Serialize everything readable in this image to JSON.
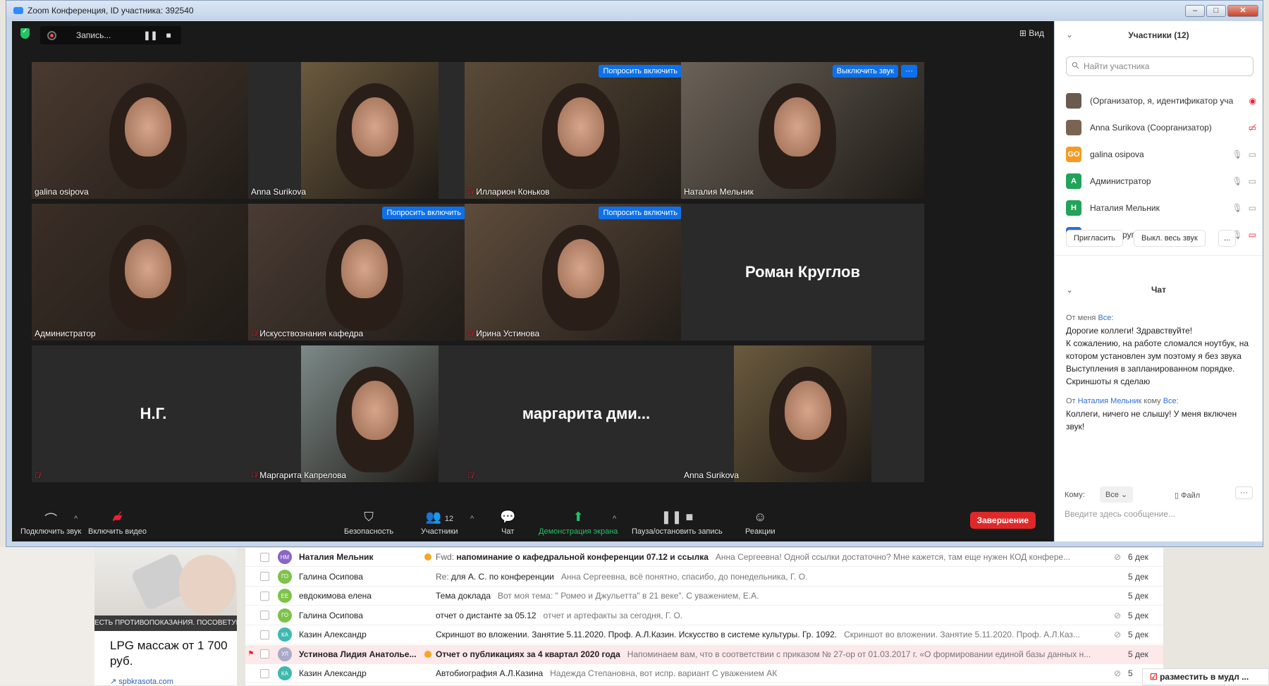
{
  "window": {
    "title": "Zoom Конференция, ID участника: 392540"
  },
  "recording": {
    "label": "Запись..."
  },
  "view_label": "Вид",
  "tiles": [
    {
      "name": "galina osipova",
      "button": "",
      "muted": false,
      "big": ""
    },
    {
      "name": "Anna Surikova",
      "button": "",
      "muted": false,
      "big": ""
    },
    {
      "name": "Илларион Коньков",
      "button": "Попросить включить",
      "muted": true,
      "big": ""
    },
    {
      "name": "Наталия Мельник",
      "button": "Выключить звук",
      "muted": false,
      "big": ""
    },
    {
      "name": "Администратор",
      "button": "",
      "muted": false,
      "big": ""
    },
    {
      "name": "Искусствознания кафедра",
      "button": "Попросить включить",
      "muted": true,
      "big": ""
    },
    {
      "name": "Ирина Устинова",
      "button": "Попросить включить",
      "muted": true,
      "big": ""
    },
    {
      "name": "",
      "button": "",
      "muted": false,
      "big": "Роман Круглов"
    },
    {
      "name": "",
      "button": "",
      "muted": true,
      "big": "Н.Г."
    },
    {
      "name": "Маргарита Капрелова",
      "button": "",
      "muted": true,
      "big": ""
    },
    {
      "name": "",
      "button": "",
      "muted": true,
      "big": "маргарита дми..."
    },
    {
      "name": "Anna Surikova",
      "button": "",
      "muted": false,
      "big": ""
    }
  ],
  "more_label": "···",
  "toolbar": {
    "audio": "Подключить звук",
    "video": "Включить видео",
    "security": "Безопасность",
    "participants": "Участники",
    "participants_count": "12",
    "chat": "Чат",
    "share": "Демонстрация экрана",
    "record": "Пауза/остановить запись",
    "reactions": "Реакции",
    "end": "Завершение"
  },
  "panel": {
    "title": "Участники (12)",
    "search_placeholder": "Найти участника",
    "participants": [
      {
        "initials": "",
        "color": "#6b5a4e",
        "name": "(Организатор, я, идентификатор уча"
      },
      {
        "initials": "",
        "color": "#7a6352",
        "name": "Anna Surikova (Соорганизатор)"
      },
      {
        "initials": "GO",
        "color": "#f59b23",
        "name": "galina osipova"
      },
      {
        "initials": "A",
        "color": "#23a35a",
        "name": "Администратор"
      },
      {
        "initials": "Н",
        "color": "#23a35a",
        "name": "Наталия Мельник"
      },
      {
        "initials": "Р",
        "color": "#2d6fd6",
        "name": "Роман Круглов"
      }
    ],
    "invite": "Пригласить",
    "mute_all": "Выкл. весь звук",
    "more": "...",
    "chat_title": "Чат",
    "messages": [
      {
        "from_prefix": "От меня",
        "to": "Все:",
        "text": "Дорогие коллеги! Здравствуйте!\nК сожалению, на работе сломался ноутбук, на котором установлен зум поэтому я без звука\nВыступления в запланированном порядке.\nСкриншоты я сделаю"
      },
      {
        "from_prefix": "От",
        "sender": "Наталия Мельник",
        "mid": "кому",
        "to": "Все:",
        "text": "Коллеги, ничего не слышу! У меня включен звук!"
      }
    ],
    "to_label": "Кому:",
    "to_value": "Все",
    "file_label": "Файл",
    "input_placeholder": "Введите здесь сообщение..."
  },
  "mail": [
    {
      "avatar": "НМ",
      "color": "#8a64c8",
      "sender": "Наталия Мельник",
      "bold": true,
      "dot": true,
      "prefix": "Fwd:",
      "subject": "напоминание о кафедральной конференции 07.12 и ссылка",
      "snippet": "Анна Сергеевна! Одной ссылки достаточно? Мне кажется, там еще нужен КОД конфере...",
      "clip": true,
      "date": "6 дек",
      "flag": false,
      "hl": false
    },
    {
      "avatar": "ГО",
      "color": "#7ec24a",
      "sender": "Галина Осипова",
      "bold": false,
      "dot": false,
      "prefix": "Re:",
      "subject": "для А. С. по конференции",
      "snippet": "Анна Сергеевна, всё понятно, спасибо, до понедельника, Г. О.",
      "clip": false,
      "date": "5 дек",
      "flag": false,
      "hl": false
    },
    {
      "avatar": "ЕЕ",
      "color": "#7ec24a",
      "sender": "евдокимова елена",
      "bold": false,
      "dot": false,
      "prefix": "",
      "subject": "Тема доклада",
      "snippet": "Вот моя тема: \" Ромео и Джульетта\" в 21 веке\". С уважением, Е.А.",
      "clip": false,
      "date": "5 дек",
      "flag": false,
      "hl": false
    },
    {
      "avatar": "ГО",
      "color": "#7ec24a",
      "sender": "Галина Осипова",
      "bold": false,
      "dot": false,
      "prefix": "",
      "subject": "отчет о дистанте за 05.12",
      "snippet": "отчет и артефакты за сегодня, Г. О.",
      "clip": true,
      "date": "5 дек",
      "flag": false,
      "hl": false
    },
    {
      "avatar": "КА",
      "color": "#3fb8b0",
      "sender": "Казин Александр",
      "bold": false,
      "dot": false,
      "prefix": "",
      "subject": "Скриншот во вложении. Занятие 5.11.2020. Проф. А.Л.Казин. Искусство в системе культуры. Гр. 1092.",
      "snippet": "Скриншот во вложении. Занятие 5.11.2020. Проф. А.Л.Каз...",
      "clip": true,
      "date": "5 дек",
      "flag": false,
      "hl": false
    },
    {
      "avatar": "УЛ",
      "color": "#a9a9c8",
      "sender": "Устинова Лидия Анатолье...",
      "bold": true,
      "dot": true,
      "prefix": "",
      "subject": "Отчет о публикациях за 4 квартал 2020 года",
      "snippet": "Напоминаем вам, что в соответствии с приказом № 27-ор от 01.03.2017 г. «О формировании единой базы данных н...",
      "clip": false,
      "date": "5 дек",
      "flag": true,
      "hl": true
    },
    {
      "avatar": "КА",
      "color": "#3fb8b0",
      "sender": "Казин Александр",
      "bold": false,
      "dot": false,
      "prefix": "",
      "subject": "Автобиография А.Л.Казина",
      "snippet": "Надежда Степановна, вот испр. вариант С уважением АК",
      "clip": true,
      "date": "5",
      "flag": false,
      "hl": false
    }
  ],
  "ad": {
    "band": "ЕСТЬ ПРОТИВОПОКАЗАНИЯ. ПОСОВЕТУЙТЕСЬ С ВРАЧОМ.",
    "title": "LPG массаж от 1 700 руб.",
    "link": "spbkrasota.com"
  },
  "vk_button": "разместить в мудл ..."
}
